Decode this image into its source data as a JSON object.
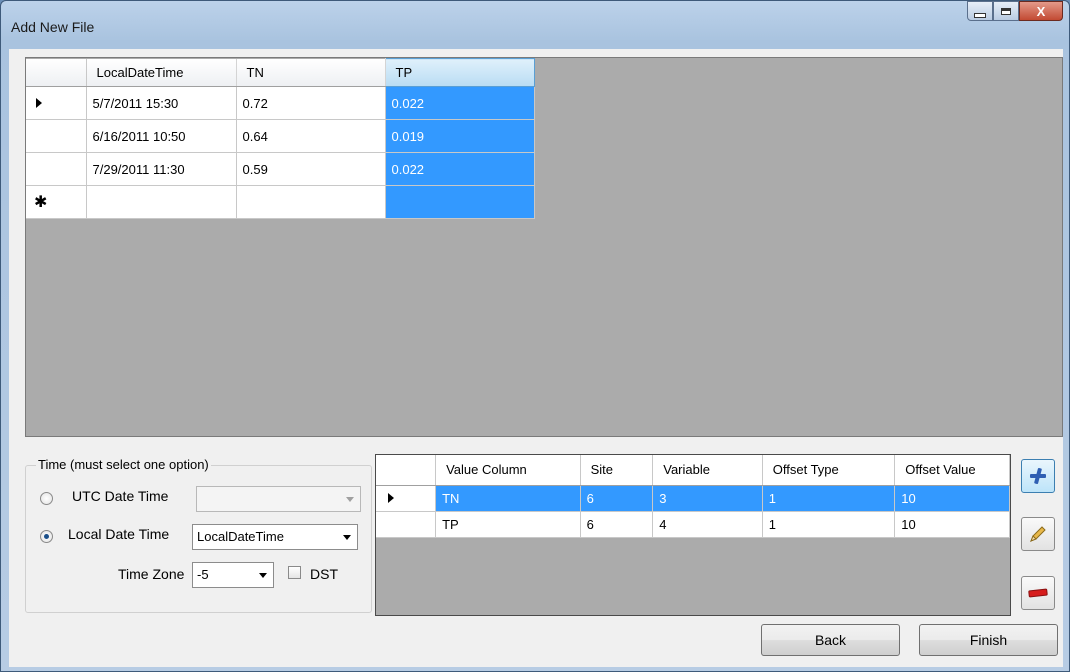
{
  "window": {
    "title": "Add New File",
    "close_glyph": "X"
  },
  "main_grid": {
    "columns": [
      "LocalDateTime",
      "TN",
      "TP"
    ],
    "rows": [
      [
        "5/7/2011 15:30",
        "0.72",
        "0.022"
      ],
      [
        "6/16/2011 10:50",
        "0.64",
        "0.019"
      ],
      [
        "7/29/2011 11:30",
        "0.59",
        "0.022"
      ]
    ],
    "new_row_glyph": "✱",
    "selected_column": "TP"
  },
  "time_group": {
    "legend": "Time (must select one option)",
    "utc_label": "UTC Date Time",
    "utc_value": "",
    "local_label": "Local Date Time",
    "local_value": "LocalDateTime",
    "local_selected": true,
    "timezone_label": "Time Zone",
    "timezone_value": "-5",
    "dst_label": "DST",
    "dst_checked": false
  },
  "mapping_grid": {
    "columns": [
      "Value Column",
      "Site",
      "Variable",
      "Offset Type",
      "Offset Value"
    ],
    "rows": [
      [
        "TN",
        "6",
        "3",
        "1",
        "10"
      ],
      [
        "TP",
        "6",
        "4",
        "1",
        "10"
      ]
    ]
  },
  "side_buttons": {
    "add_icon": "add-icon",
    "edit_icon": "pencil-icon",
    "remove_icon": "remove-icon"
  },
  "footer": {
    "back_label": "Back",
    "finish_label": "Finish"
  },
  "colors": {
    "selection": "#3399ff",
    "grid_background": "#ababab",
    "remove": "#d61c1c"
  }
}
